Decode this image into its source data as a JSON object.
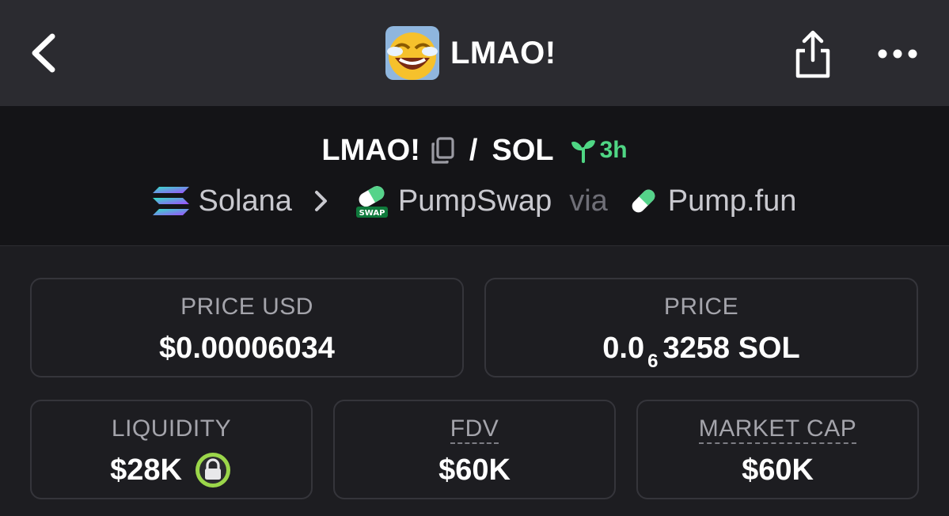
{
  "header": {
    "title": "LMAO!"
  },
  "pair": {
    "base": "LMAO!",
    "separator": "/",
    "quote": "SOL",
    "age": "3h",
    "chain": "Solana",
    "dex": "PumpSwap",
    "via": "via",
    "launchpad": "Pump.fun",
    "swap_badge": "SWAP"
  },
  "stats": {
    "price_usd": {
      "label": "PRICE USD",
      "value": "$0.00006034"
    },
    "price_native": {
      "label": "PRICE",
      "prefix": "0.0",
      "zeros": "6",
      "suffix": "3258 SOL"
    },
    "liquidity": {
      "label": "LIQUIDITY",
      "value": "$28K"
    },
    "fdv": {
      "label": "FDV",
      "value": "$60K"
    },
    "market_cap": {
      "label": "MARKET CAP",
      "value": "$60K"
    }
  },
  "colors": {
    "accent_green": "#4fd684",
    "lock_ring": "#9bd64a"
  },
  "icons": [
    "back-icon",
    "token-logo",
    "share-icon",
    "more-icon",
    "copy-icon",
    "sprout-icon",
    "solana-icon",
    "chevron-right-icon",
    "pumpswap-icon",
    "pumpfun-pill-icon",
    "lock-icon"
  ]
}
